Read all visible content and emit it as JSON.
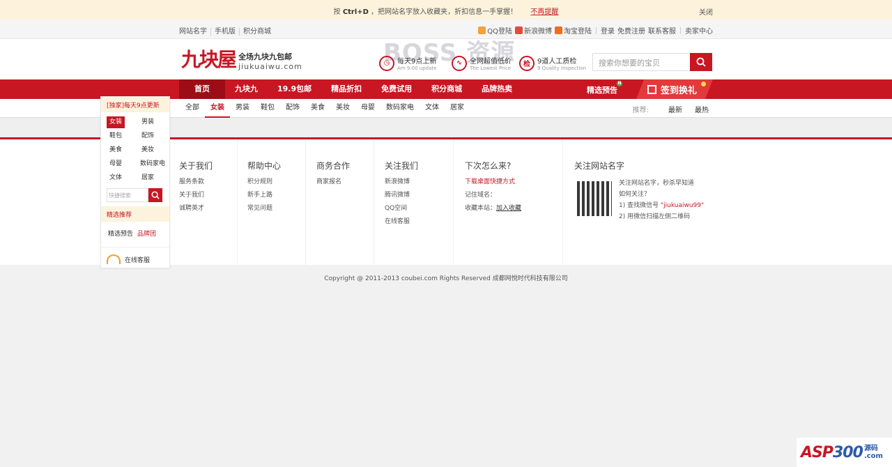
{
  "notice": {
    "prefix": "按",
    "keys": "Ctrl+D",
    "msg": "，把网站名字放入收藏夹，折扣信息一手掌握！",
    "no_more": "不再提醒",
    "close": "关闭"
  },
  "toplinks": {
    "left": [
      "网站名字",
      "手机版",
      "积分商城"
    ],
    "qq": "QQ登陆",
    "weibo": "新浪微博",
    "taobao": "淘宝登陆",
    "login": "登录",
    "register": "免费注册",
    "contact": "联系客服",
    "seller": "卖家中心"
  },
  "header": {
    "logo_big": "九块屋",
    "logo_t1": "全场九块九包邮",
    "logo_t2": "jiukuaiwu.com",
    "watermark": "BOSS 资源",
    "features": [
      {
        "icon": "clock",
        "l1": "每天9点上新",
        "l2": "Am 9:00 update"
      },
      {
        "icon": "trend",
        "l1": "全网超值低价",
        "l2": "The Lowest Price"
      },
      {
        "icon": "检",
        "l1": "9道人工质检",
        "l2": "9 Quality Inspection"
      }
    ],
    "search_placeholder": "搜索你想要的宝贝"
  },
  "nav": {
    "items": [
      "首页",
      "九块九",
      "19.9包邮",
      "精品折扣",
      "免费试用",
      "积分商城",
      "品牌热卖"
    ],
    "preview": "精选预告",
    "preview_badge": "N",
    "sign": "签到换礼"
  },
  "subnav": {
    "cats": [
      "全部",
      "女装",
      "男装",
      "鞋包",
      "配饰",
      "美食",
      "美妆",
      "母婴",
      "数码家电",
      "文体",
      "居家"
    ],
    "sort_label": "推荐:",
    "sort": [
      "最新",
      "最热"
    ]
  },
  "side": {
    "header": "[独家]每天9点更新",
    "cats": [
      "女装",
      "男装",
      "鞋包",
      "配饰",
      "美食",
      "美妆",
      "母婴",
      "数码家电",
      "文体",
      "居家"
    ],
    "search_placeholder": "快捷搜索",
    "rec_header": "精选推荐",
    "rec_a": "精选预告",
    "rec_b": "品牌团",
    "service": "在线客服"
  },
  "footer": {
    "about": {
      "title": "关于我们",
      "links": [
        "服务条款",
        "关于我们",
        "诚聘英才"
      ]
    },
    "help": {
      "title": "帮助中心",
      "links": [
        "积分规则",
        "新手上路",
        "常见问题"
      ]
    },
    "biz": {
      "title": "商务合作",
      "links": [
        "商家报名"
      ]
    },
    "follow": {
      "title": "关注我们",
      "links": [
        "新浪微博",
        "腾讯微博",
        "QQ空间",
        "在线客服"
      ]
    },
    "next": {
      "title": "下次怎么来?",
      "download": "下载桌面快捷方式",
      "remember": "记住域名：",
      "fav_label": "收藏本站：",
      "fav_link": "加入收藏"
    },
    "site": {
      "title": "关注网站名字",
      "l1": "关注网站名字，秒杀早知道",
      "l2": "如何关注？",
      "l3a": "1) 查找微信号",
      "l3b": "\"jiukuaiwu99\"",
      "l4": "2) 用微信扫描左侧二维码"
    }
  },
  "copyright": "Copyright @ 2011-2013 coubei.com Rights Reserved 成都网悦时代科技有限公司",
  "corner": {
    "a": "ASP",
    "b": "300",
    "c": "源码",
    "d": ".com"
  }
}
